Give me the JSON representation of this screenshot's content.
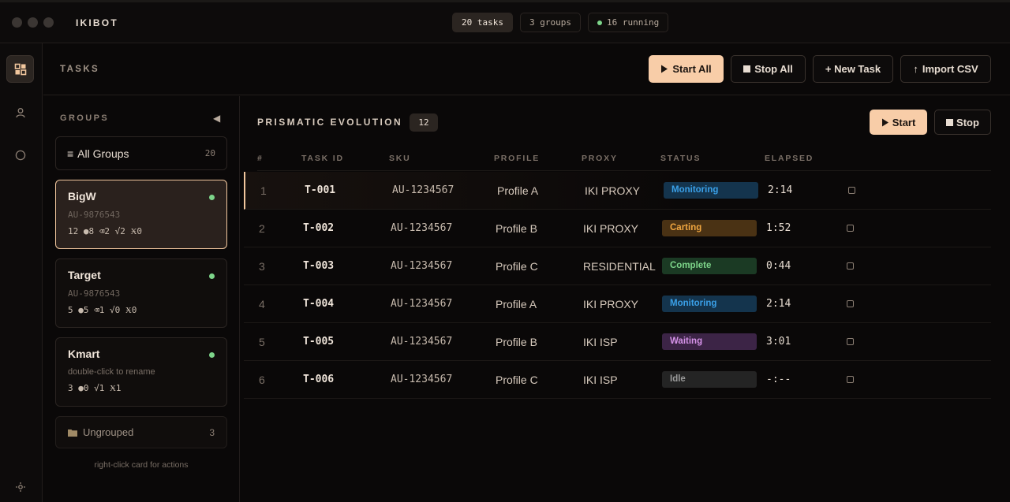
{
  "app": {
    "name": "IKIBOT",
    "pills": [
      {
        "label": "20 tasks"
      },
      {
        "label": "3 groups"
      },
      {
        "label": "16 running"
      }
    ]
  },
  "rail": {
    "icons": [
      "grid-icon",
      "user-icon",
      "circle-icon",
      "settings-icon"
    ]
  },
  "header": {
    "title": "TASKS",
    "buttons": {
      "start_all": "Start All",
      "stop_all": "Stop All",
      "new_task": "+ New Task",
      "import_csv": "Import CSV"
    }
  },
  "groups": {
    "title": "GROUPS",
    "all_groups_label": "All Groups",
    "all_groups_count": "20",
    "cards": [
      {
        "name": "BigW",
        "sub": "AU-9876543",
        "stats": "12 ●8 ⌫2 √2 Ӿ0"
      },
      {
        "name": "Target",
        "sub": "AU-9876543",
        "stats": "5 ●5 ⌫1 √0 Ӿ0"
      },
      {
        "name": "Kmart",
        "sub": "double-click to rename",
        "stats": "3 ●0 √1 Ӿ1"
      }
    ],
    "ungrouped_label": "Ungrouped",
    "ungrouped_count": "3",
    "hint": "right-click card for actions"
  },
  "main": {
    "section_title": "PRISMATIC EVOLUTION",
    "section_count": "12",
    "start": "Start",
    "stop": "Stop",
    "columns": [
      "#",
      "TASK ID",
      "SKU",
      "PROFILE",
      "PROXY",
      "STATUS",
      "ELAPSED"
    ],
    "rows": [
      {
        "num": "1",
        "id": "T-001",
        "sku": "AU-1234567",
        "profile": "Profile A",
        "proxy": "IKI PROXY",
        "status": "Monitoring",
        "elapsed": "2:14"
      },
      {
        "num": "2",
        "id": "T-002",
        "sku": "AU-1234567",
        "profile": "Profile B",
        "proxy": "IKI PROXY",
        "status": "Carting",
        "elapsed": "1:52"
      },
      {
        "num": "3",
        "id": "T-003",
        "sku": "AU-1234567",
        "profile": "Profile C",
        "proxy": "RESIDENTIAL",
        "status": "Complete",
        "elapsed": "0:44"
      },
      {
        "num": "4",
        "id": "T-004",
        "sku": "AU-1234567",
        "profile": "Profile A",
        "proxy": "IKI PROXY",
        "status": "Monitoring",
        "elapsed": "2:14"
      },
      {
        "num": "5",
        "id": "T-005",
        "sku": "AU-1234567",
        "profile": "Profile B",
        "proxy": "IKI ISP",
        "status": "Waiting",
        "elapsed": "3:01"
      },
      {
        "num": "6",
        "id": "T-006",
        "sku": "AU-1234567",
        "profile": "Profile C",
        "proxy": "IKI ISP",
        "status": "Idle",
        "elapsed": "-:--"
      }
    ]
  },
  "colors": {
    "accent": "#f8cda8",
    "running": "#7dd58a",
    "monitoring": "#3aa0e8",
    "carting": "#f0a640",
    "complete": "#7dd58a",
    "waiting": "#d592e8",
    "idle": "#9a9a9a"
  }
}
